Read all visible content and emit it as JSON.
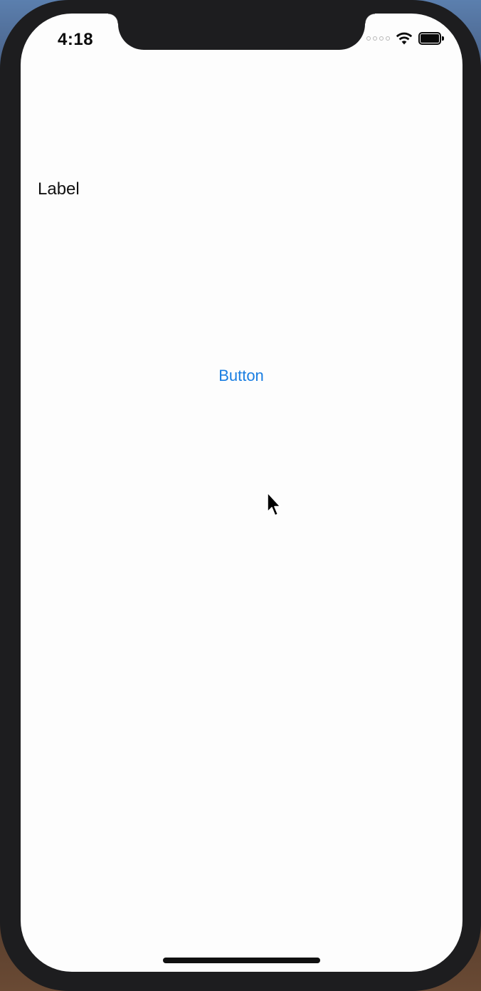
{
  "status_bar": {
    "time": "4:18",
    "signal_icon": "cellular-signal-dots-icon",
    "wifi_icon": "wifi-icon",
    "battery_icon": "battery-icon",
    "battery_level": 1.0
  },
  "main": {
    "label_text": "Label",
    "button_text": "Button"
  },
  "colors": {
    "screen_bg": "#fdfdfd",
    "button_tint": "#1a7ee2",
    "frame": "#1d1d1f"
  },
  "overlay": {
    "cursor_icon": "mouse-pointer-icon"
  }
}
